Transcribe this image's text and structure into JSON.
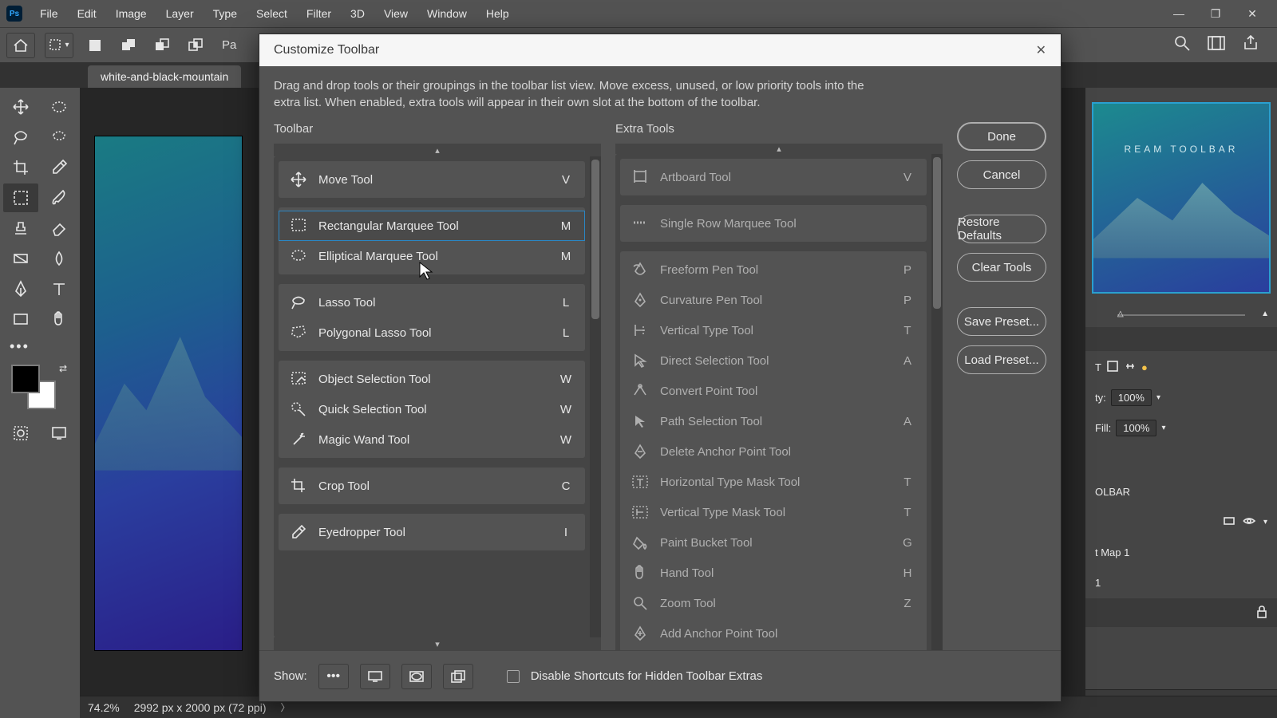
{
  "menu": {
    "items": [
      "File",
      "Edit",
      "Image",
      "Layer",
      "Type",
      "Select",
      "Filter",
      "3D",
      "View",
      "Window",
      "Help"
    ]
  },
  "doc_tab": "white-and-black-mountain",
  "status": {
    "zoom": "74.2%",
    "dims": "2992 px x 2000 px (72 ppi)"
  },
  "rightpanel": {
    "preview_label": "REAM TOOLBAR",
    "opacity_label": "ty:",
    "opacity_value": "100%",
    "fill_label": "Fill:",
    "fill_value": "100%",
    "layer1": "OLBAR",
    "layer2": "t Map 1",
    "layer3": "1"
  },
  "dialog": {
    "title": "Customize Toolbar",
    "desc": "Drag and drop tools or their groupings in the toolbar list view. Move excess, unused, or low priority tools into the extra list. When enabled, extra tools will appear in their own slot at the bottom of the toolbar.",
    "left_header": "Toolbar",
    "right_header": "Extra Tools",
    "buttons": {
      "done": "Done",
      "cancel": "Cancel",
      "restore": "Restore Defaults",
      "clear": "Clear Tools",
      "save": "Save Preset...",
      "load": "Load Preset..."
    },
    "footer": {
      "show_label": "Show:",
      "disable_label": "Disable Shortcuts for Hidden Toolbar Extras"
    },
    "toolbar_groups": [
      [
        {
          "name": "Move Tool",
          "key": "V",
          "icon": "move"
        }
      ],
      [
        {
          "name": "Rectangular Marquee Tool",
          "key": "M",
          "icon": "rect-marquee",
          "selected": true
        },
        {
          "name": "Elliptical Marquee Tool",
          "key": "M",
          "icon": "ellipse-marquee"
        }
      ],
      [
        {
          "name": "Lasso Tool",
          "key": "L",
          "icon": "lasso"
        },
        {
          "name": "Polygonal Lasso Tool",
          "key": "L",
          "icon": "poly-lasso"
        }
      ],
      [
        {
          "name": "Object Selection Tool",
          "key": "W",
          "icon": "obj-sel"
        },
        {
          "name": "Quick Selection Tool",
          "key": "W",
          "icon": "quick-sel"
        },
        {
          "name": "Magic Wand Tool",
          "key": "W",
          "icon": "wand"
        }
      ],
      [
        {
          "name": "Crop Tool",
          "key": "C",
          "icon": "crop"
        }
      ],
      [
        {
          "name": "Eyedropper Tool",
          "key": "I",
          "icon": "eyedropper"
        }
      ]
    ],
    "extra_groups": [
      [
        {
          "name": "Artboard Tool",
          "key": "V",
          "icon": "artboard"
        }
      ],
      [
        {
          "name": "Single Row Marquee Tool",
          "key": "",
          "icon": "row-marquee"
        }
      ],
      [
        {
          "name": "Freeform Pen Tool",
          "key": "P",
          "icon": "freeform-pen"
        },
        {
          "name": "Curvature Pen Tool",
          "key": "P",
          "icon": "curve-pen"
        },
        {
          "name": "Vertical Type Tool",
          "key": "T",
          "icon": "vtype"
        },
        {
          "name": "Direct Selection Tool",
          "key": "A",
          "icon": "direct-sel"
        },
        {
          "name": "Convert Point Tool",
          "key": "",
          "icon": "convert-pt"
        },
        {
          "name": "Path Selection Tool",
          "key": "A",
          "icon": "path-sel"
        },
        {
          "name": "Delete Anchor Point Tool",
          "key": "",
          "icon": "del-anchor"
        },
        {
          "name": "Horizontal Type Mask Tool",
          "key": "T",
          "icon": "htype-mask"
        },
        {
          "name": "Vertical Type Mask Tool",
          "key": "T",
          "icon": "vtype-mask"
        },
        {
          "name": "Paint Bucket Tool",
          "key": "G",
          "icon": "bucket"
        },
        {
          "name": "Hand Tool",
          "key": "H",
          "icon": "hand"
        },
        {
          "name": "Zoom Tool",
          "key": "Z",
          "icon": "zoom"
        },
        {
          "name": "Add Anchor Point Tool",
          "key": "",
          "icon": "add-anchor"
        }
      ]
    ]
  }
}
